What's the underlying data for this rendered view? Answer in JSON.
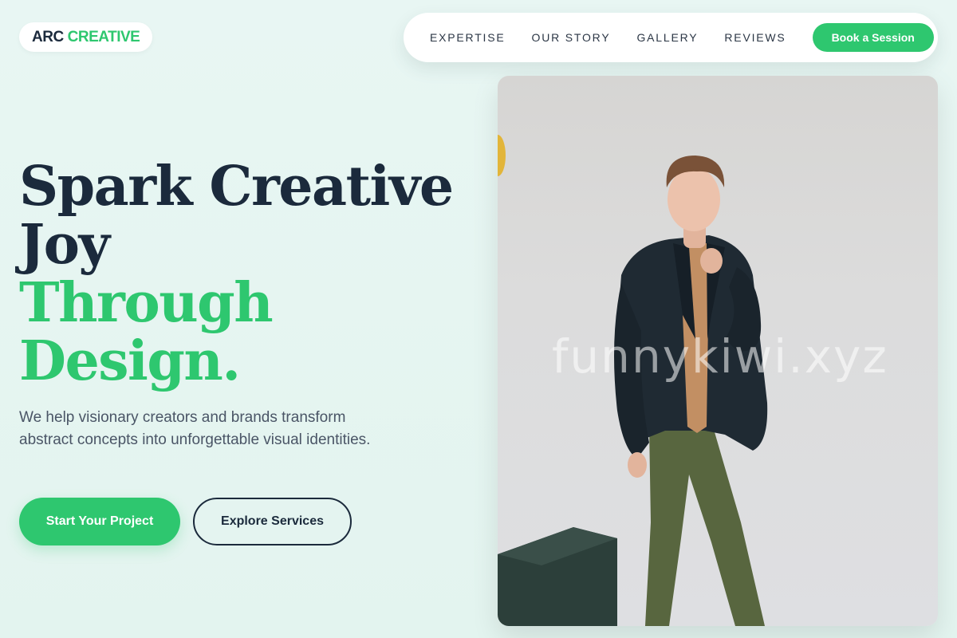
{
  "brand": {
    "part1": "ARC",
    "part2": "CREATIVE"
  },
  "nav": {
    "links": [
      "EXPERTISE",
      "OUR STORY",
      "GALLERY",
      "REVIEWS"
    ],
    "cta": "Book a Session"
  },
  "hero": {
    "title_line1": "Spark Creative",
    "title_line2": "Joy",
    "title_line3": "Through",
    "title_line4": "Design.",
    "subtitle": "We help visionary creators and brands transform abstract concepts into unforgettable visual identities.",
    "primary_button": "Start Your Project",
    "secondary_button": "Explore Services"
  },
  "image": {
    "watermark": "funnykiwi.xyz"
  },
  "colors": {
    "accent": "#2ec76f",
    "dark": "#1b2a3c",
    "background": "#e6f5f1"
  }
}
